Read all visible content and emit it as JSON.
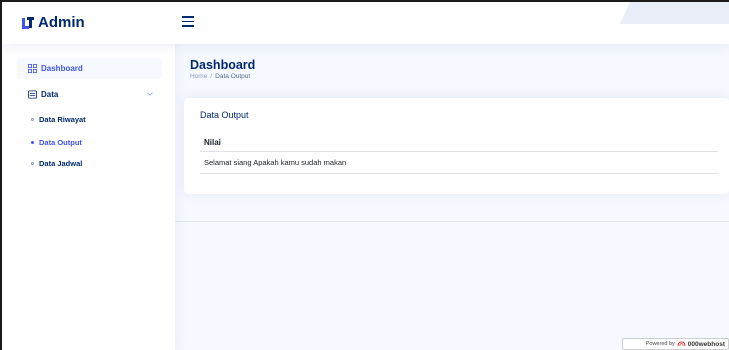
{
  "header": {
    "app_title": "Admin",
    "logo_icon": "admin-logo-icon",
    "menu_icon": "hamburger-icon"
  },
  "sidebar": {
    "items": [
      {
        "label": "Dashboard",
        "icon": "grid-icon",
        "active": true
      },
      {
        "label": "Data",
        "icon": "menu-list-icon",
        "expanded": true,
        "children": [
          {
            "label": "Data Riwayat",
            "active": false
          },
          {
            "label": "Data Output",
            "active": true
          },
          {
            "label": "Data Jadwal",
            "active": false
          }
        ]
      }
    ]
  },
  "main": {
    "page_title": "Dashboard",
    "breadcrumb": {
      "home": "Home",
      "separator": "/",
      "current": "Data Output"
    },
    "card": {
      "title": "Data Output",
      "table": {
        "headers": [
          "Nilai"
        ],
        "rows": [
          [
            "Selamat siang Apakah kamu sudah makan"
          ]
        ]
      }
    }
  },
  "footer_badge": {
    "prefix": "Powered by",
    "brand": "000webhost"
  },
  "colors": {
    "primary": "#012970",
    "accent": "#4154f1",
    "muted": "#899bbd",
    "background": "#f6f9ff"
  }
}
